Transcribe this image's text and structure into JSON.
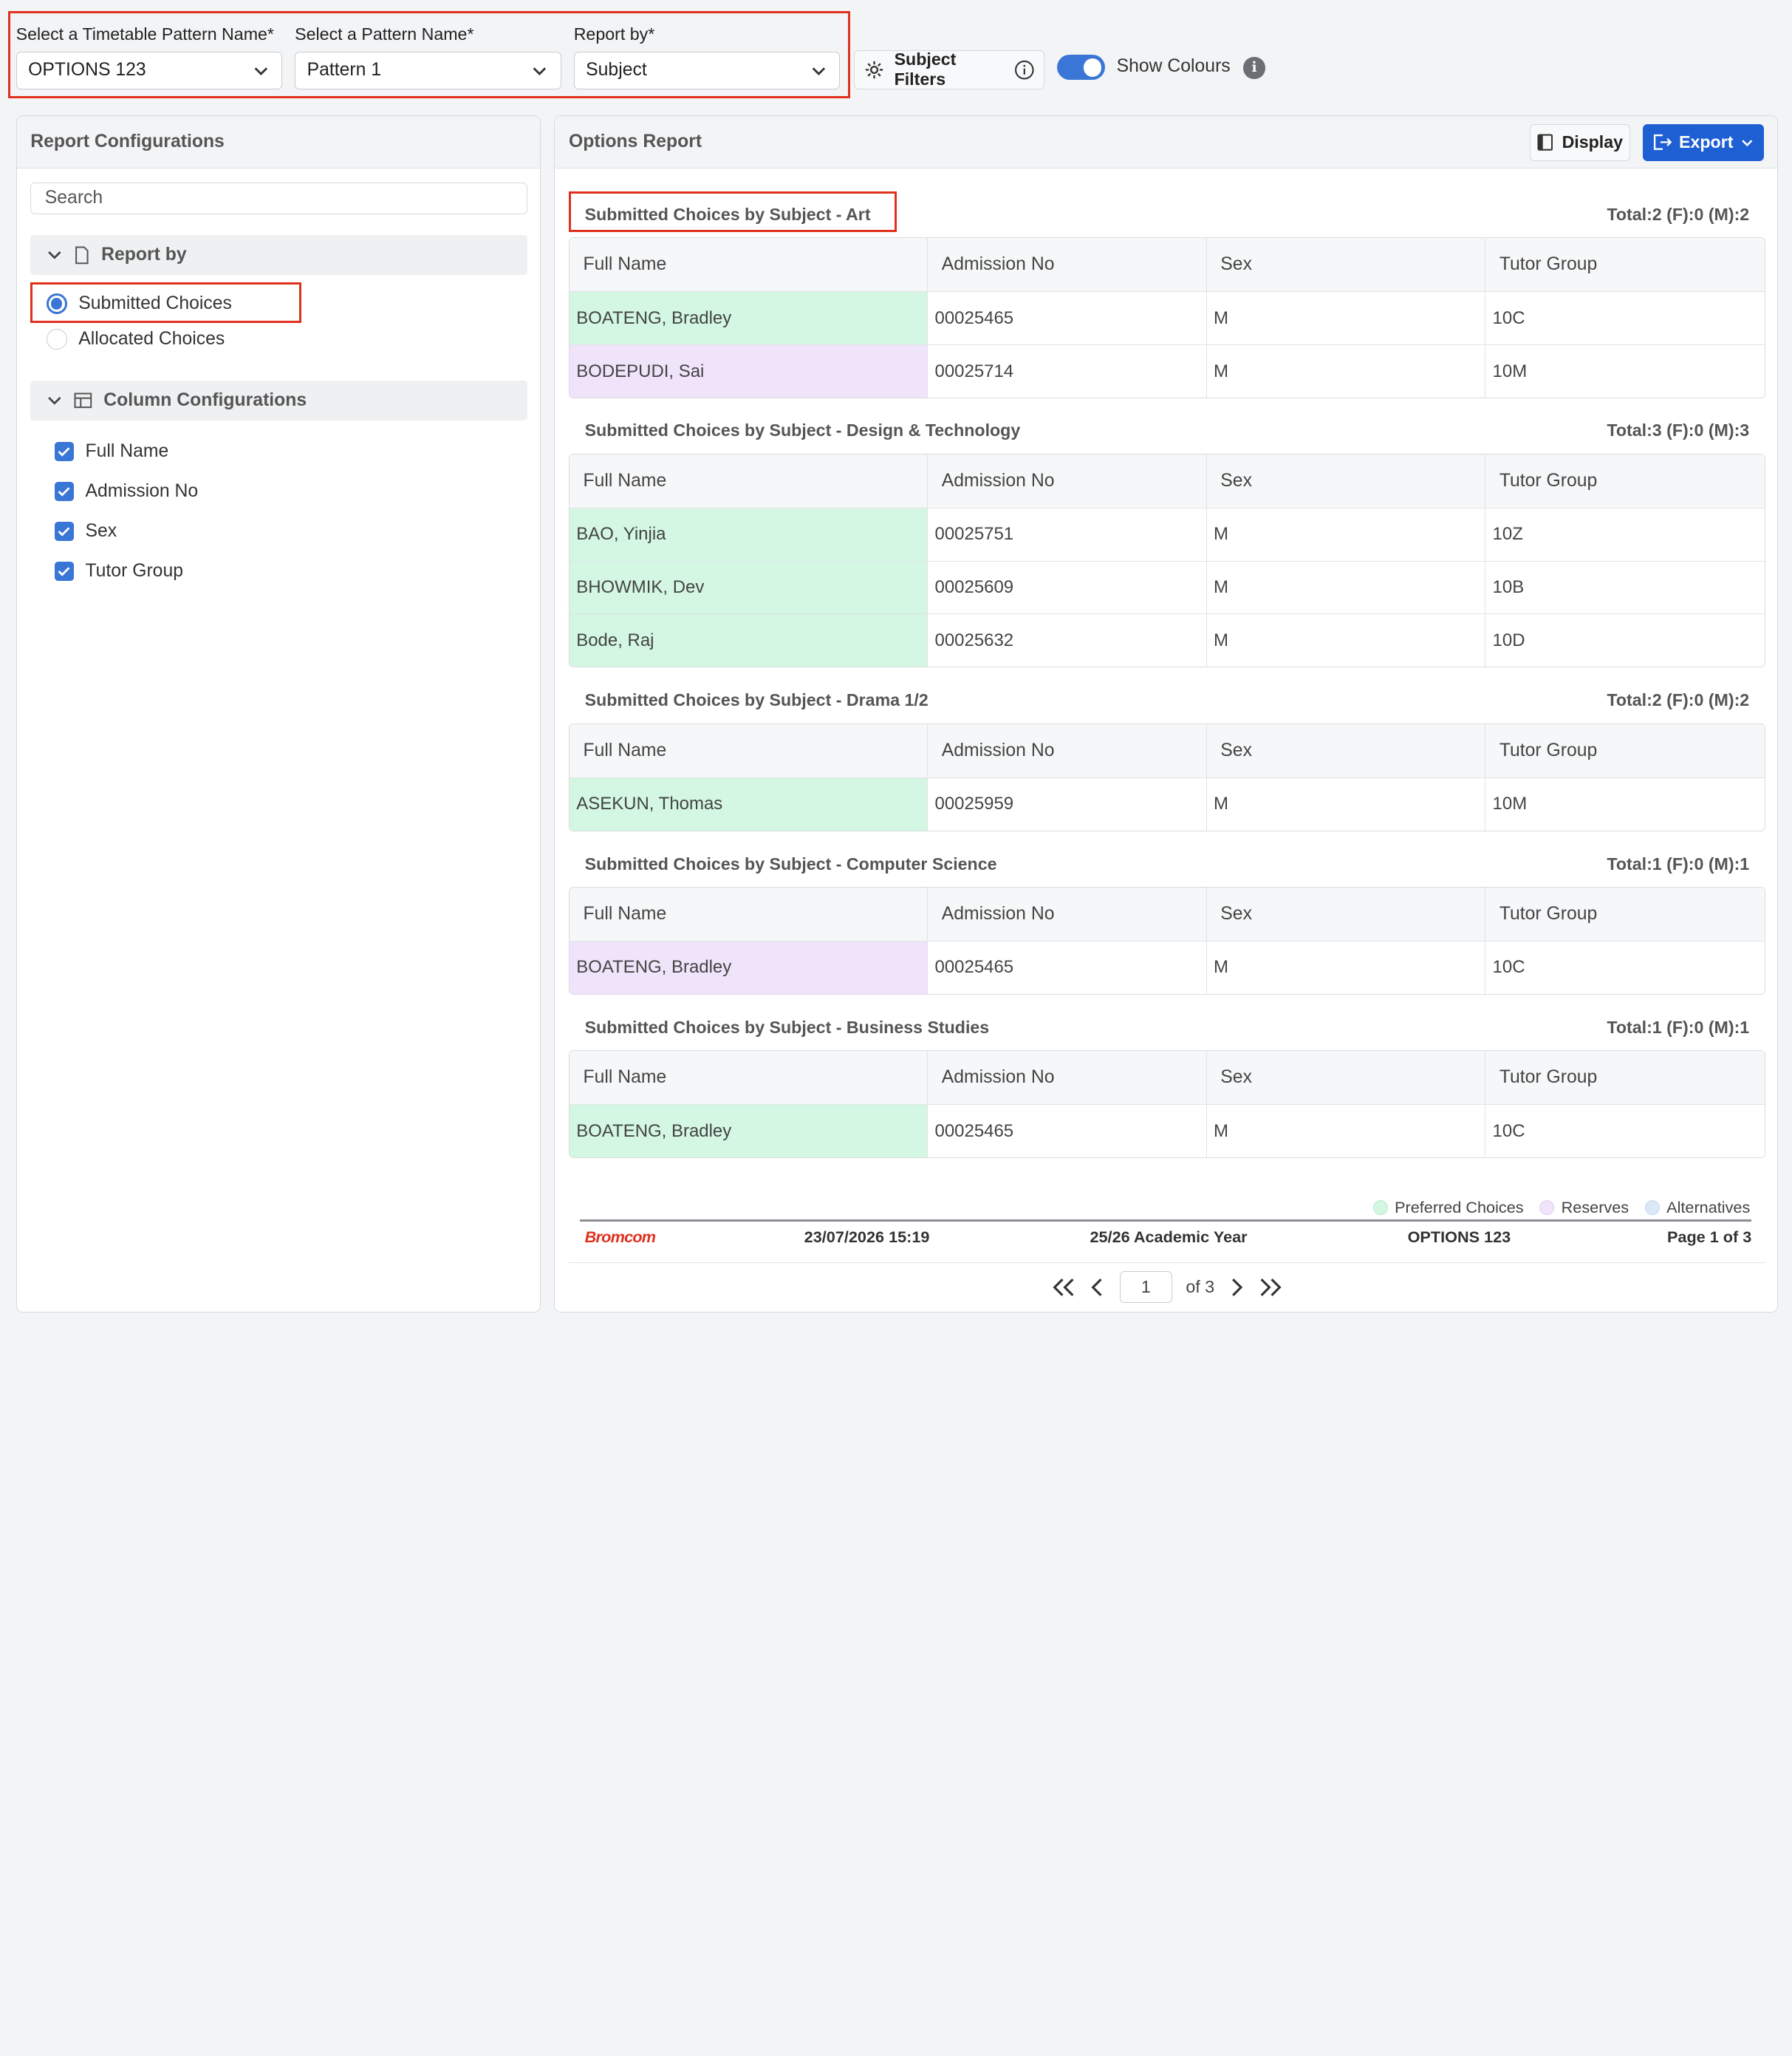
{
  "filters": {
    "timetable": {
      "label": "Select a Timetable Pattern Name*",
      "value": "OPTIONS 123"
    },
    "pattern": {
      "label": "Select a Pattern Name*",
      "value": "Pattern 1"
    },
    "report_by": {
      "label": "Report by*",
      "value": "Subject"
    },
    "subject_filters_label": "Subject Filters",
    "show_colours_label": "Show Colours",
    "show_colours_on": true
  },
  "left_panel": {
    "title": "Report Configurations",
    "search_placeholder": "Search",
    "report_by_title": "Report by",
    "options": [
      {
        "label": "Submitted Choices",
        "selected": true
      },
      {
        "label": "Allocated Choices",
        "selected": false
      }
    ],
    "columns_title": "Column Configurations",
    "columns": [
      "Full Name",
      "Admission No",
      "Sex",
      "Tutor Group"
    ]
  },
  "right_panel": {
    "title": "Options Report",
    "display_label": "Display",
    "export_label": "Export",
    "headers": [
      "Full Name",
      "Admission No",
      "Sex",
      "Tutor Group"
    ],
    "groups": [
      {
        "title": "Submitted Choices by Subject - Art",
        "total": "Total:2 (F):0 (M):2",
        "rows": [
          {
            "name": "BOATENG, Bradley",
            "adm": "00025465",
            "sex": "M",
            "tutor": "10C",
            "type": "preferred"
          },
          {
            "name": "BODEPUDI, Sai",
            "adm": "00025714",
            "sex": "M",
            "tutor": "10M",
            "type": "reserve"
          }
        ]
      },
      {
        "title": "Submitted Choices by Subject - Design & Technology",
        "total": "Total:3 (F):0 (M):3",
        "rows": [
          {
            "name": "BAO, Yinjia",
            "adm": "00025751",
            "sex": "M",
            "tutor": "10Z",
            "type": "preferred"
          },
          {
            "name": "BHOWMIK, Dev",
            "adm": "00025609",
            "sex": "M",
            "tutor": "10B",
            "type": "preferred"
          },
          {
            "name": "Bode, Raj",
            "adm": "00025632",
            "sex": "M",
            "tutor": "10D",
            "type": "preferred"
          }
        ]
      },
      {
        "title": "Submitted Choices by Subject - Drama 1/2",
        "total": "Total:2 (F):0 (M):2",
        "rows": [
          {
            "name": "ASEKUN, Thomas",
            "adm": "00025959",
            "sex": "M",
            "tutor": "10M",
            "type": "preferred"
          }
        ]
      },
      {
        "title": "Submitted Choices by Subject - Computer Science",
        "total": "Total:1 (F):0 (M):1",
        "rows": [
          {
            "name": "BOATENG, Bradley",
            "adm": "00025465",
            "sex": "M",
            "tutor": "10C",
            "type": "reserve"
          }
        ]
      },
      {
        "title": "Submitted Choices by Subject - Business Studies",
        "total": "Total:1 (F):0 (M):1",
        "rows": [
          {
            "name": "BOATENG, Bradley",
            "adm": "00025465",
            "sex": "M",
            "tutor": "10C",
            "type": "preferred"
          }
        ]
      }
    ],
    "legend": [
      {
        "label": "Preferred Choices",
        "color": "#d3f7e3"
      },
      {
        "label": "Reserves",
        "color": "#f0e4fb"
      },
      {
        "label": "Alternatives",
        "color": "#dbe8f8"
      }
    ],
    "footer": {
      "brand": "Bromcom",
      "datetime": "23/07/2026 15:19",
      "academic_year": "25/26 Academic Year",
      "pattern": "OPTIONS 123",
      "page_info": "Page 1 of 3"
    },
    "pager": {
      "current": "1",
      "of_label": "of 3"
    }
  },
  "colors": {
    "accent": "#3a76d6",
    "export": "#1f5fd4",
    "highlight": "#e0301e",
    "preferred": "#d3f7e3",
    "reserve": "#f0e4fb"
  }
}
